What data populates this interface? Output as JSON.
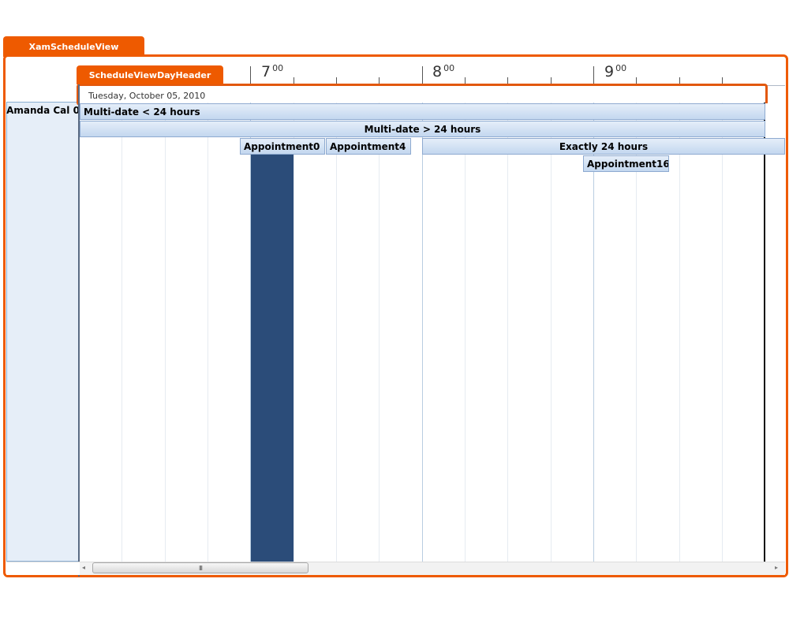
{
  "labels": {
    "schedule_view": "XamScheduleView",
    "day_header": "ScheduleViewDayHeader"
  },
  "timeline": {
    "hours": [
      {
        "hour": "7",
        "minutes": "00"
      },
      {
        "hour": "8",
        "minutes": "00"
      },
      {
        "hour": "9",
        "minutes": "00"
      }
    ],
    "date": "Tuesday, October 05, 2010"
  },
  "resource": {
    "name": "Amanda Cal 0"
  },
  "appointments": {
    "multi_date_short": "Multi-date < 24 hours",
    "multi_date_long": "Multi-date > 24 hours",
    "appt0": "Appointment0",
    "appt4": "Appointment4",
    "exactly_24": "Exactly 24 hours",
    "appt16": "Appointment16"
  },
  "scrollbar": {
    "left_arrow": "◂",
    "right_arrow": "▸",
    "grip": "III"
  },
  "colors": {
    "callout_orange": "#ee5a00",
    "appointment_fill": "#c3d7ef",
    "busy_block": "#2b4c79"
  }
}
